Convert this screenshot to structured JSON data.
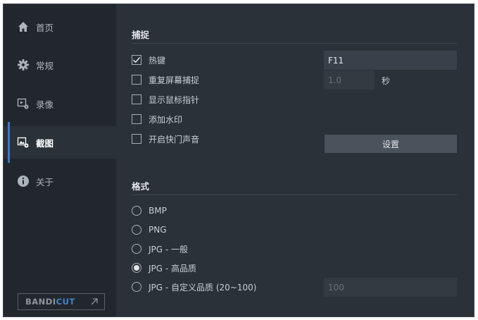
{
  "sidebar": {
    "items": [
      {
        "label": "首页",
        "icon": "home-icon"
      },
      {
        "label": "常规",
        "icon": "gear-icon"
      },
      {
        "label": "录像",
        "icon": "video-settings-icon"
      },
      {
        "label": "截图",
        "icon": "screenshot-settings-icon",
        "active": true
      },
      {
        "label": "关于",
        "icon": "info-icon"
      }
    ],
    "brand": {
      "part1": "BANDI",
      "part2": "CUT",
      "arrow": "↗"
    }
  },
  "capture": {
    "title": "捕捉",
    "hotkey": {
      "label": "热键",
      "checked": true,
      "value": "F11"
    },
    "repeat": {
      "label": "重复屏幕捕捉",
      "checked": false,
      "value": "1.0",
      "unit": "秒"
    },
    "cursor": {
      "label": "显示鼠标指针",
      "checked": false
    },
    "watermark": {
      "label": "添加水印",
      "checked": false
    },
    "shutter": {
      "label": "开启快门声音",
      "checked": false
    },
    "settings_button": "设置"
  },
  "format": {
    "title": "格式",
    "options": [
      {
        "label": "BMP",
        "selected": false
      },
      {
        "label": "PNG",
        "selected": false
      },
      {
        "label": "JPG - 一般",
        "selected": false
      },
      {
        "label": "JPG - 高品质",
        "selected": true
      },
      {
        "label": "JPG - 自定义品质 (20~100)",
        "selected": false
      }
    ],
    "custom_quality_value": "100"
  },
  "colors": {
    "window_bg": "#2b3138",
    "sidebar_bg": "#22272d",
    "accent": "#3d79c9",
    "button_bg": "#4a525c"
  }
}
